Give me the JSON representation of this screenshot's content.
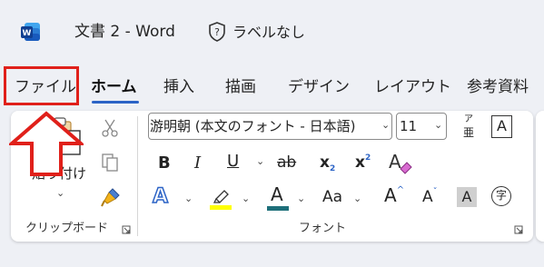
{
  "titlebar": {
    "document_title": "文書 2  -  Word",
    "sensitivity_label": "ラベルなし"
  },
  "tabs": [
    {
      "label": "ファイル"
    },
    {
      "label": "ホーム",
      "selected": true
    },
    {
      "label": "挿入"
    },
    {
      "label": "描画"
    },
    {
      "label": "デザイン"
    },
    {
      "label": "レイアウト"
    },
    {
      "label": "参考資料"
    }
  ],
  "ribbon": {
    "clipboard": {
      "paste_label": "貼り付け",
      "group_label": "クリップボード"
    },
    "font": {
      "font_name": "游明朝 (本文のフォント - 日本語)",
      "font_size": "11",
      "group_label": "フォント",
      "bold": "B",
      "italic": "I",
      "underline": "U",
      "strikethrough": "ab",
      "subscript": "x",
      "subscript_mark": "2",
      "superscript": "x",
      "superscript_mark": "2",
      "text_effects": "A",
      "font_color": "A",
      "change_case": "Aa",
      "grow_font": "A",
      "shrink_font": "A",
      "char_shading": "A",
      "enclose_char": "字",
      "phonetic_top": "ア",
      "phonetic_bottom": "亜",
      "char_border": "A"
    }
  },
  "colors": {
    "highlight_annotation": "#e0201a",
    "word_blue": "#185abd",
    "highlight_yellow": "#ffff00",
    "font_color_bar": "#1e6f7a",
    "selected_tab_underline": "#2b63c6"
  }
}
